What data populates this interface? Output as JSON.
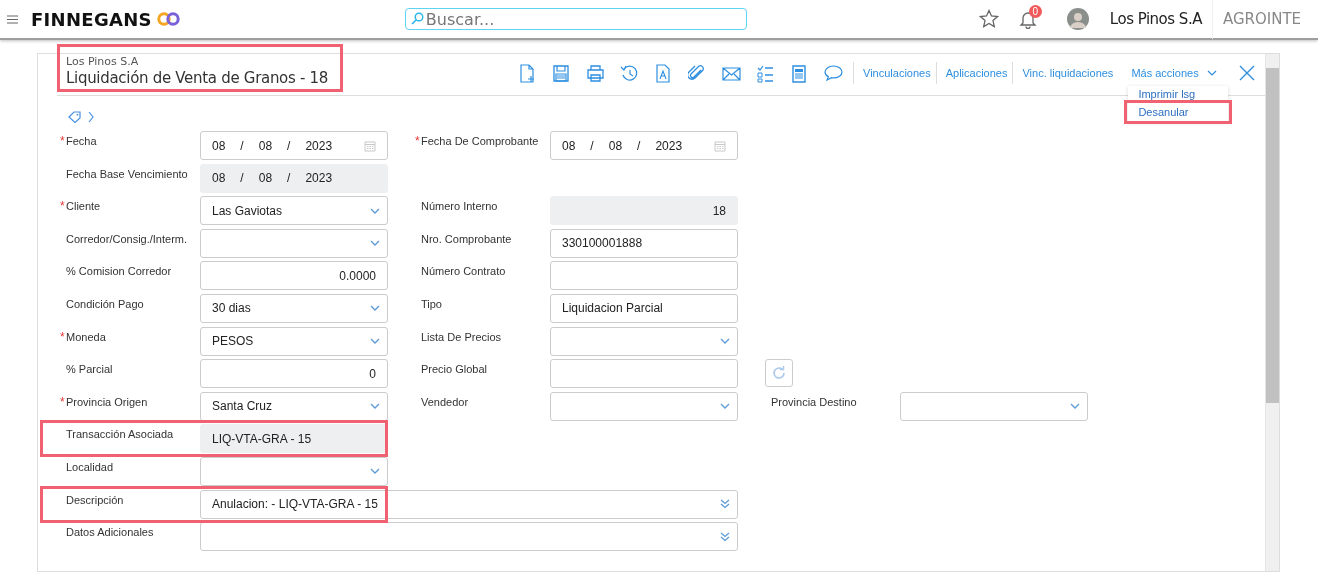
{
  "app": {
    "brand": "FINNEGANS",
    "search": {
      "placeholder": "Buscar..."
    },
    "notifications": "0",
    "company": "Los Pinos S.A",
    "tenant": "AGROINTE"
  },
  "document": {
    "company": "Los Pinos S.A",
    "title": "Liquidación de Venta de Granos - 18",
    "highlighted": true,
    "toolbar_links": [
      "Vinculaciones",
      "Aplicaciones",
      "Vinc. liquidaciones"
    ],
    "more_actions": {
      "label": "Más acciones",
      "expanded": true,
      "items": [
        {
          "label": "Imprimir lsg",
          "highlighted": false
        },
        {
          "label": "Desanular",
          "highlighted": true
        }
      ]
    },
    "form": [
      {
        "left": {
          "marker": "*",
          "label": "Fecha",
          "field": {
            "kind": "date",
            "day": "08",
            "month": "08",
            "year": "2023",
            "separator": "/",
            "disabled": false
          }
        },
        "right": {
          "marker": "*",
          "label": "Fecha De Comprobante",
          "field": {
            "kind": "date",
            "day": "08",
            "month": "08",
            "year": "2023",
            "separator": "/",
            "disabled": false
          }
        }
      },
      {
        "left": {
          "label": "Fecha Base Vencimiento",
          "field": {
            "kind": "date",
            "day": "08",
            "month": "08",
            "year": "2023",
            "separator": "/",
            "disabled": true
          }
        }
      },
      {
        "left": {
          "marker": "*",
          "label": "Cliente",
          "field": {
            "kind": "select",
            "value": "Las Gaviotas"
          }
        },
        "right": {
          "label": "Número Interno",
          "field": {
            "kind": "number",
            "value": "18",
            "disabled": true
          }
        }
      },
      {
        "left": {
          "label": "Corredor/Consig./Interm.",
          "field": {
            "kind": "select"
          }
        },
        "right": {
          "label": "Nro. Comprobante",
          "field": {
            "kind": "text",
            "value": "330100001888",
            "disabled": false
          }
        }
      },
      {
        "left": {
          "label": "% Comision Corredor",
          "field": {
            "kind": "number",
            "value": "0.0000",
            "disabled": false
          }
        },
        "right": {
          "label": "Número Contrato",
          "field": {
            "kind": "text",
            "disabled": false
          }
        }
      },
      {
        "left": {
          "label": "Condición Pago",
          "field": {
            "kind": "select",
            "value": "30 dias"
          }
        },
        "right": {
          "label": "Tipo",
          "field": {
            "kind": "text",
            "value": "Liquidacion Parcial",
            "disabled": false
          }
        }
      },
      {
        "left": {
          "marker": "*",
          "label": "Moneda",
          "field": {
            "kind": "select",
            "value": "PESOS"
          }
        },
        "right": {
          "label": "Lista De Precios",
          "field": {
            "kind": "select"
          }
        }
      },
      {
        "left": {
          "label": "% Parcial",
          "field": {
            "kind": "number",
            "value": "0",
            "disabled": false
          }
        },
        "right": {
          "label": "Precio Global",
          "field": {
            "kind": "text",
            "disabled": false
          }
        },
        "extra": {
          "field": {
            "kind": "refresh"
          }
        }
      },
      {
        "left": {
          "marker": "*",
          "label": "Provincia Origen",
          "field": {
            "kind": "select",
            "value": "Santa Cruz"
          }
        },
        "right": {
          "label": "Vendedor",
          "field": {
            "kind": "select"
          }
        },
        "extra": {
          "label": "Provincia Destino",
          "field": {
            "kind": "select"
          }
        }
      },
      {
        "left": {
          "label": "Transacción Asociada",
          "highlighted": true,
          "field": {
            "kind": "text",
            "value": "LIQ-VTA-GRA - 15",
            "disabled": true
          }
        }
      },
      {
        "left": {
          "label": "Localidad",
          "field": {
            "kind": "select"
          }
        }
      },
      {
        "left": {
          "label": "Descripción",
          "highlighted": true,
          "field": {
            "kind": "memo",
            "value": "Anulacion: - LIQ-VTA-GRA - 15"
          }
        }
      },
      {
        "left": {
          "label": "Datos Adicionales",
          "field": {
            "kind": "memo"
          }
        }
      }
    ]
  }
}
